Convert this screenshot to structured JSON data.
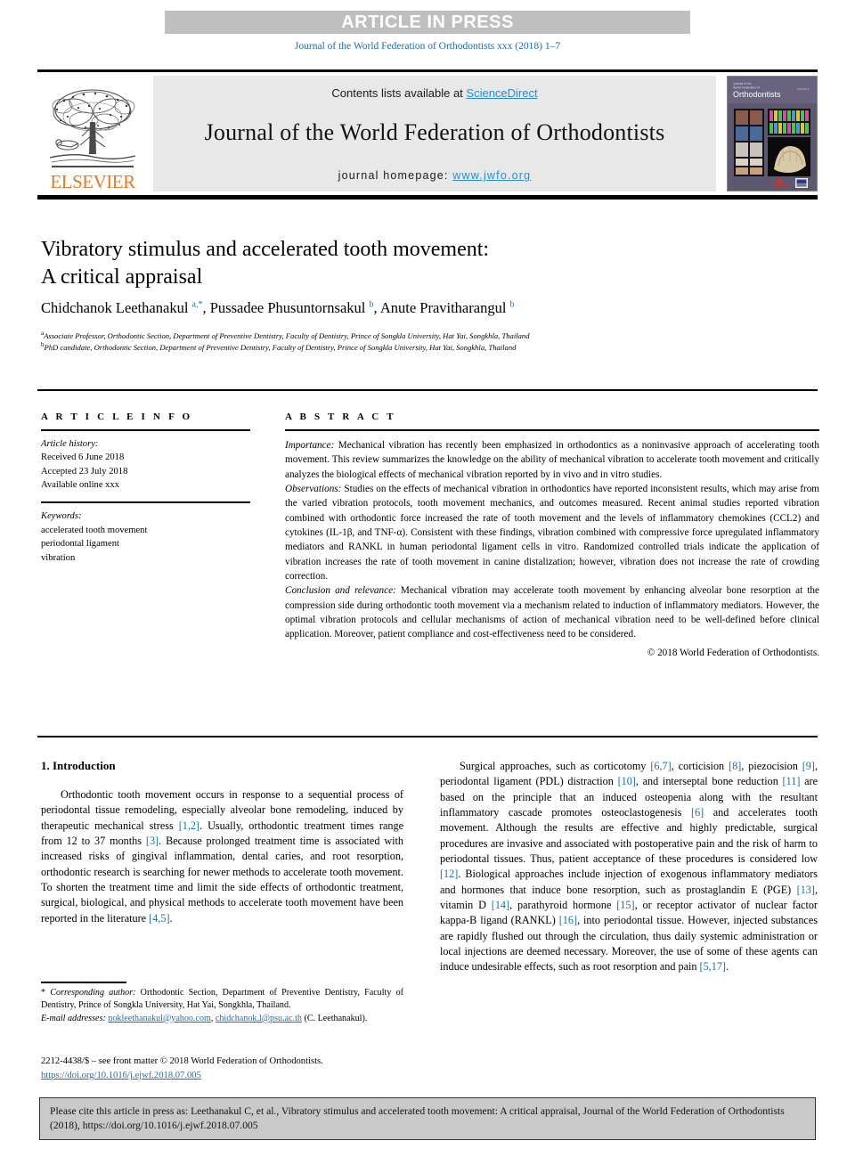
{
  "header": {
    "banner": "ARTICLE IN PRESS",
    "journal_ref": "Journal of the World Federation of Orthodontists xxx (2018) 1–7"
  },
  "masthead": {
    "contents_prefix": "Contents lists available at ",
    "sciencedirect": "ScienceDirect",
    "journal_title": "Journal of the World Federation of Orthodontists",
    "homepage_prefix": "journal homepage: ",
    "homepage_url": "www.jwfo.org",
    "publisher": "ELSEVIER",
    "cover_title_small": "Journal of the\nWorld Federation of",
    "cover_title": "Orthodontists"
  },
  "article": {
    "title_line1": "Vibratory stimulus and accelerated tooth movement:",
    "title_line2": "A critical appraisal",
    "authors_html": "Chidchanok Leethanakul <sup>a,*</sup>, Pussadee Phusuntornsakul <sup>b</sup>, Anute Pravitharangul <sup>b</sup>",
    "affiliation_a": "Associate Professor, Orthodontic Section, Department of Preventive Dentistry, Faculty of Dentistry, Prince of Songkla University, Hat Yai, Songkhla, Thailand",
    "affiliation_b": "PhD candidate, Orthodontic Section, Department of Preventive Dentistry, Faculty of Dentistry, Prince of Songkla University, Hat Yai, Songkhla, Thailand"
  },
  "info": {
    "heading": "A R T I C L E   I N F O",
    "history_label": "Article history:",
    "received": "Received 6 June 2018",
    "accepted": "Accepted 23 July 2018",
    "available": "Available online xxx",
    "keywords_label": "Keywords:",
    "keywords": [
      "accelerated tooth movement",
      "periodontal ligament",
      "vibration"
    ]
  },
  "abstract": {
    "heading": "A B S T R A C T",
    "importance_label": "Importance:",
    "importance_text": " Mechanical vibration has recently been emphasized in orthodontics as a noninvasive approach of accelerating tooth movement. This review summarizes the knowledge on the ability of mechanical vibration to accelerate tooth movement and critically analyzes the biological effects of mechanical vibration reported by in vivo and in vitro studies.",
    "observations_label": "Observations:",
    "observations_text": " Studies on the effects of mechanical vibration in orthodontics have reported inconsistent results, which may arise from the varied vibration protocols, tooth movement mechanics, and outcomes measured. Recent animal studies reported vibration combined with orthodontic force increased the rate of tooth movement and the levels of inflammatory chemokines (CCL2) and cytokines (IL-1β, and TNF-α). Consistent with these findings, vibration combined with compressive force upregulated inflammatory mediators and RANKL in human periodontal ligament cells in vitro. Randomized controlled trials indicate the application of vibration increases the rate of tooth movement in canine distalization; however, vibration does not increase the rate of crowding correction.",
    "conclusion_label": "Conclusion and relevance:",
    "conclusion_text": " Mechanical vibration may accelerate tooth movement by enhancing alveolar bone resorption at the compression side during orthodontic tooth movement via a mechanism related to induction of inflammatory mediators. However, the optimal vibration protocols and cellular mechanisms of action of mechanical vibration need to be well-defined before clinical application. Moreover, patient compliance and cost-effectiveness need to be considered.",
    "copyright": "© 2018 World Federation of Orthodontists."
  },
  "body": {
    "section_heading": "1. Introduction",
    "left_paragraph_parts": [
      {
        "t": "Orthodontic tooth movement occurs in response to a sequential process of periodontal tissue remodeling, especially alveolar bone remodeling, induced by therapeutic mechanical stress "
      },
      {
        "t": "[1,2]",
        "ref": true
      },
      {
        "t": ". Usually, orthodontic treatment times range from 12 to 37 months "
      },
      {
        "t": "[3]",
        "ref": true
      },
      {
        "t": ". Because prolonged treatment time is associated with increased risks of gingival inflammation, dental caries, and root resorption, orthodontic research is searching for newer methods to accelerate tooth movement. To shorten the treatment time and limit the side effects of orthodontic treatment, surgical, biological, and physical methods to accelerate tooth movement have been reported in the literature "
      },
      {
        "t": "[4,5]",
        "ref": true
      },
      {
        "t": "."
      }
    ],
    "right_paragraph_parts": [
      {
        "t": "Surgical approaches, such as corticotomy "
      },
      {
        "t": "[6,7]",
        "ref": true
      },
      {
        "t": ", corticision "
      },
      {
        "t": "[8]",
        "ref": true
      },
      {
        "t": ", piezocision "
      },
      {
        "t": "[9]",
        "ref": true
      },
      {
        "t": ", periodontal ligament (PDL) distraction "
      },
      {
        "t": "[10]",
        "ref": true
      },
      {
        "t": ", and interseptal bone reduction "
      },
      {
        "t": "[11]",
        "ref": true
      },
      {
        "t": " are based on the principle that an induced osteopenia along with the resultant inflammatory cascade promotes osteoclastogenesis "
      },
      {
        "t": "[6]",
        "ref": true
      },
      {
        "t": " and accelerates tooth movement. Although the results are effective and highly predictable, surgical procedures are invasive and associated with postoperative pain and the risk of harm to periodontal tissues. Thus, patient acceptance of these procedures is considered low "
      },
      {
        "t": "[12]",
        "ref": true
      },
      {
        "t": ". Biological approaches include injection of exogenous inflammatory mediators and hormones that induce bone resorption, such as prostaglandin E (PGE) "
      },
      {
        "t": "[13]",
        "ref": true
      },
      {
        "t": ", vitamin D "
      },
      {
        "t": "[14]",
        "ref": true
      },
      {
        "t": ", parathyroid hormone "
      },
      {
        "t": "[15]",
        "ref": true
      },
      {
        "t": ", or receptor activator of nuclear factor kappa-B ligand (RANKL) "
      },
      {
        "t": "[16]",
        "ref": true
      },
      {
        "t": ", into periodontal tissue. However, injected substances are rapidly flushed out through the circulation, thus daily systemic administration or local injections are deemed necessary. Moreover, the use of some of these agents can induce undesirable effects, such as root resorption and pain "
      },
      {
        "t": "[5,17]",
        "ref": true
      },
      {
        "t": "."
      }
    ]
  },
  "footnote": {
    "star": "*",
    "corresponding_label": "Corresponding author:",
    "corresponding_text": " Orthodontic Section, Department of Preventive Dentistry, Faculty of Dentistry, Prince of Songkla University, Hat Yai, Songkhla, Thailand.",
    "email_label": "E-mail addresses:",
    "email1": "nokleethanakul@yahoo.com",
    "email_sep": ", ",
    "email2": "chidchanok.l@psu.ac.th",
    "email_suffix": " (C. Leethanakul)."
  },
  "issn": {
    "line1": "2212-4438/$ – see front matter © 2018 World Federation of Orthodontists.",
    "doi": "https://doi.org/10.1016/j.ejwf.2018.07.005"
  },
  "cite_box": {
    "text": "Please cite this article in press as: Leethanakul C, et al., Vibratory stimulus and accelerated tooth movement: A critical appraisal, Journal of the World Federation of Orthodontists (2018), https://doi.org/10.1016/j.ejwf.2018.07.005"
  },
  "colors": {
    "link": "#1a6fa8",
    "sciencedirect": "#2b8ccc",
    "elsevier_orange": "#E87722",
    "banner_gray": "#bfbfbf",
    "masthead_gray": "#e8e8e8",
    "cite_gray": "#c9c9c9"
  }
}
